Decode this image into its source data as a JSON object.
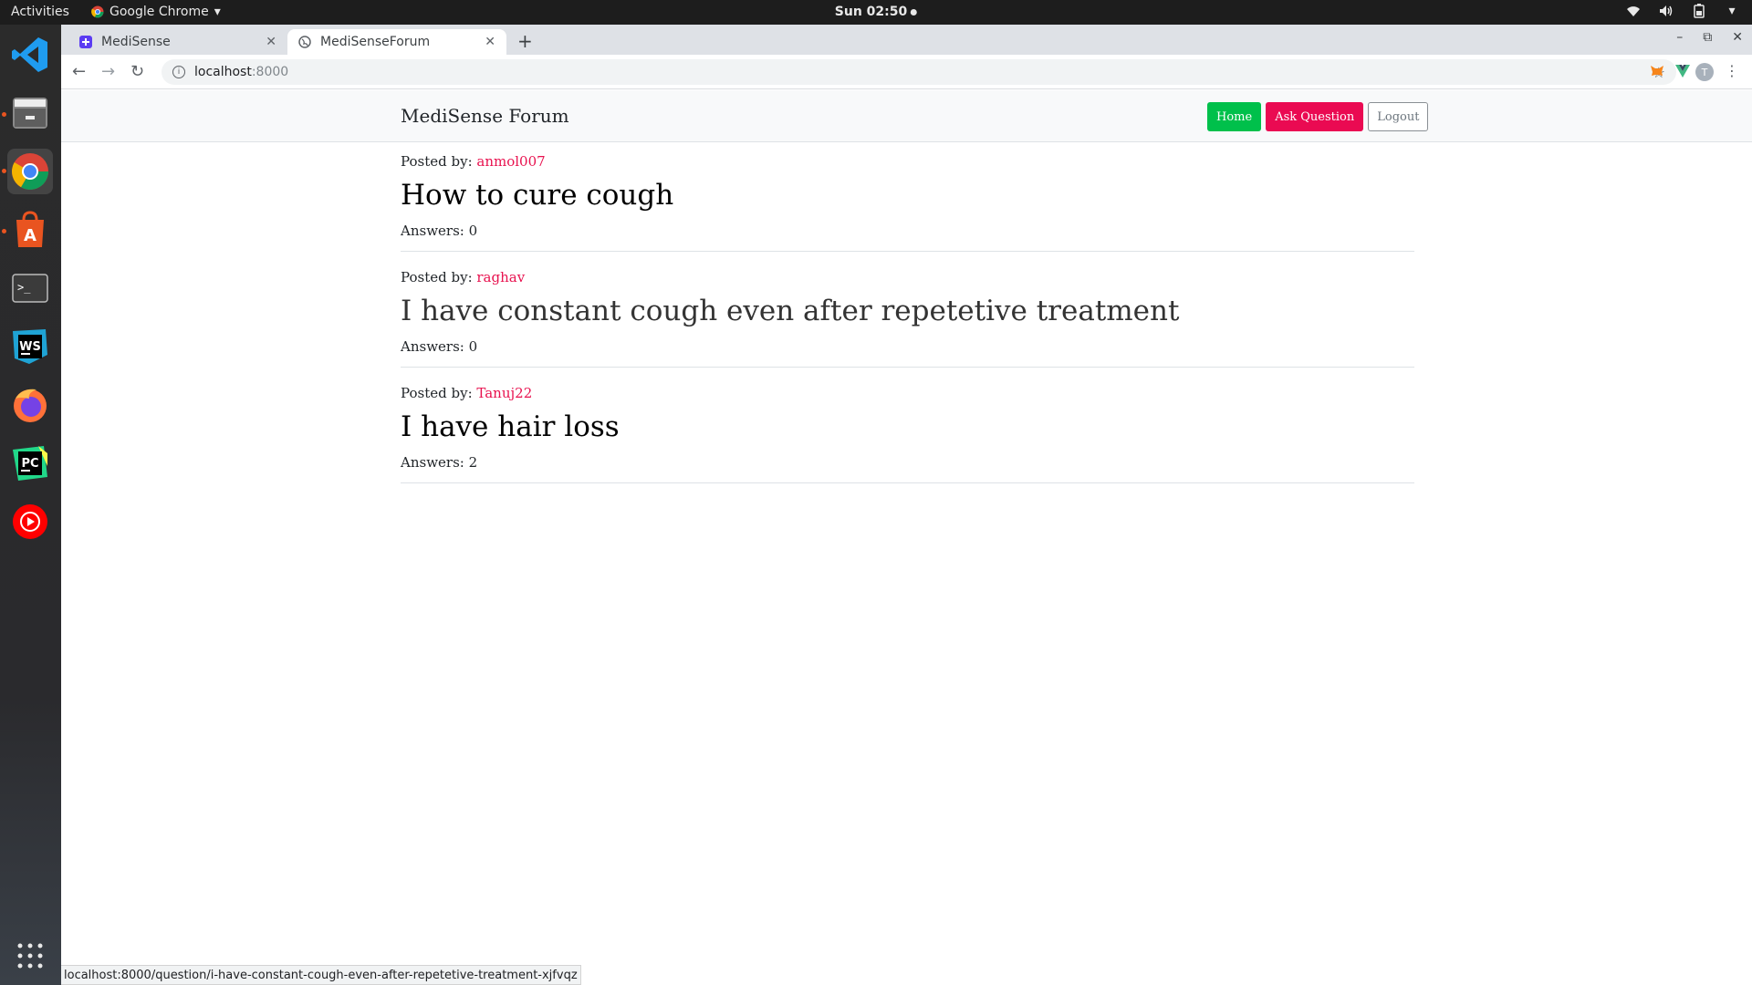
{
  "topbar": {
    "activities": "Activities",
    "app_name": "Google Chrome",
    "clock": "Sun 02:50"
  },
  "dock": {
    "items": [
      {
        "name": "vscode-icon",
        "label": "VS Code"
      },
      {
        "name": "files-icon",
        "label": "Files"
      },
      {
        "name": "chrome-icon",
        "label": "Google Chrome"
      },
      {
        "name": "software-center-icon",
        "label": "Ubuntu Software"
      },
      {
        "name": "terminal-icon",
        "label": "Terminal"
      },
      {
        "name": "webstorm-icon",
        "label": "WebStorm"
      },
      {
        "name": "firefox-icon",
        "label": "Firefox"
      },
      {
        "name": "pycharm-icon",
        "label": "PyCharm"
      },
      {
        "name": "youtube-music-icon",
        "label": "YouTube Music"
      }
    ]
  },
  "browser": {
    "tabs": [
      {
        "title": "MediSense",
        "active": false
      },
      {
        "title": "MediSenseForum",
        "active": true
      }
    ],
    "url_host": "localhost",
    "url_port": ":8000",
    "profile_initial": "T",
    "status_url": "localhost:8000/question/i-have-constant-cough-even-after-repetetive-treatment-xjfvqz"
  },
  "page": {
    "brand": "MediSense Forum",
    "nav": {
      "home": "Home",
      "ask": "Ask Question",
      "logout": "Logout"
    },
    "posted_by_label": "Posted by: ",
    "answers_label": "Answers: ",
    "questions": [
      {
        "author": "anmol007",
        "title": "How to cure cough",
        "answers": "0"
      },
      {
        "author": "raghav",
        "title": "I have constant cough even after repetetive treatment",
        "answers": "0"
      },
      {
        "author": "Tanuj22",
        "title": "I have hair loss",
        "answers": "2"
      }
    ]
  },
  "colors": {
    "home_button": "#00c04b",
    "ask_button": "#ea0a52",
    "author_link": "#e8124f"
  }
}
